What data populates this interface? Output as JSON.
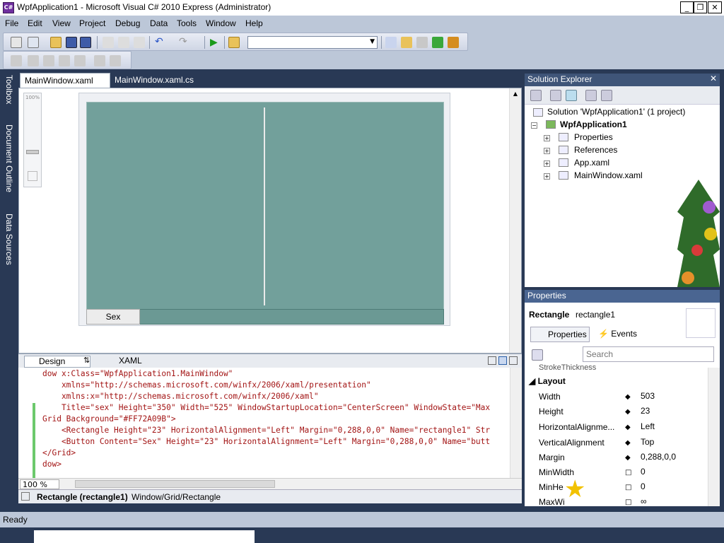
{
  "window": {
    "title": "WpfApplication1 - Microsoft Visual C# 2010 Express (Administrator)",
    "icon_text": "C#",
    "minimize": "_",
    "maximize": "❐",
    "close": "✕"
  },
  "menu": [
    "File",
    "Edit",
    "View",
    "Project",
    "Debug",
    "Data",
    "Tools",
    "Window",
    "Help"
  ],
  "left_strip": [
    "Toolbox",
    "Document Outline",
    "Data Sources"
  ],
  "doc_tabs": [
    {
      "label": "MainWindow.xaml",
      "active": true,
      "close": "✕"
    },
    {
      "label": "MainWindow.xaml.cs",
      "active": false
    }
  ],
  "designer": {
    "zoom_label": "100%",
    "button_label": "Sex",
    "grid_color": "#72A09B"
  },
  "split": {
    "design_tab": "Design",
    "swap": "⇅",
    "xaml_tab": "XAML"
  },
  "xaml_lines": [
    "dow x:Class=\"WpfApplication1.MainWindow\"",
    "    xmlns=\"http://schemas.microsoft.com/winfx/2006/xaml/presentation\"",
    "    xmlns:x=\"http://schemas.microsoft.com/winfx/2006/xaml\"",
    "    Title=\"sex\" Height=\"350\" Width=\"525\" WindowStartupLocation=\"CenterScreen\" WindowState=\"Max",
    "Grid Background=\"#FF72A09B\">",
    "    <Rectangle Height=\"23\" HorizontalAlignment=\"Left\" Margin=\"0,288,0,0\" Name=\"rectangle1\" Str",
    "    <Button Content=\"Sex\" Height=\"23\" HorizontalAlignment=\"Left\" Margin=\"0,288,0,0\" Name=\"butt",
    "</Grid>",
    "dow>"
  ],
  "zoom_select": "100 %",
  "breadcrumb": {
    "element": "Rectangle (rectangle1)",
    "path": "Window/Grid/Rectangle"
  },
  "status": "Ready",
  "solution_explorer": {
    "title": "Solution Explorer",
    "solution": "Solution 'WpfApplication1' (1 project)",
    "project": "WpfApplication1",
    "items": [
      "Properties",
      "References",
      "App.xaml",
      "MainWindow.xaml"
    ]
  },
  "properties": {
    "title": "Properties",
    "type": "Rectangle",
    "name": "rectangle1",
    "tab_properties": "Properties",
    "tab_events": "Events",
    "search_placeholder": "Search",
    "cut_row": "StrokeThickness",
    "section": "Layout",
    "rows": [
      {
        "name": "Width",
        "value": "503"
      },
      {
        "name": "Height",
        "value": "23"
      },
      {
        "name": "HorizontalAlignme...",
        "value": "Left"
      },
      {
        "name": "VerticalAlignment",
        "value": "Top"
      },
      {
        "name": "Margin",
        "value": "0,288,0,0"
      },
      {
        "name": "MinWidth",
        "value": "0"
      },
      {
        "name": "MinHe",
        "value": "0"
      },
      {
        "name": "MaxWi",
        "value": "∞"
      }
    ]
  }
}
